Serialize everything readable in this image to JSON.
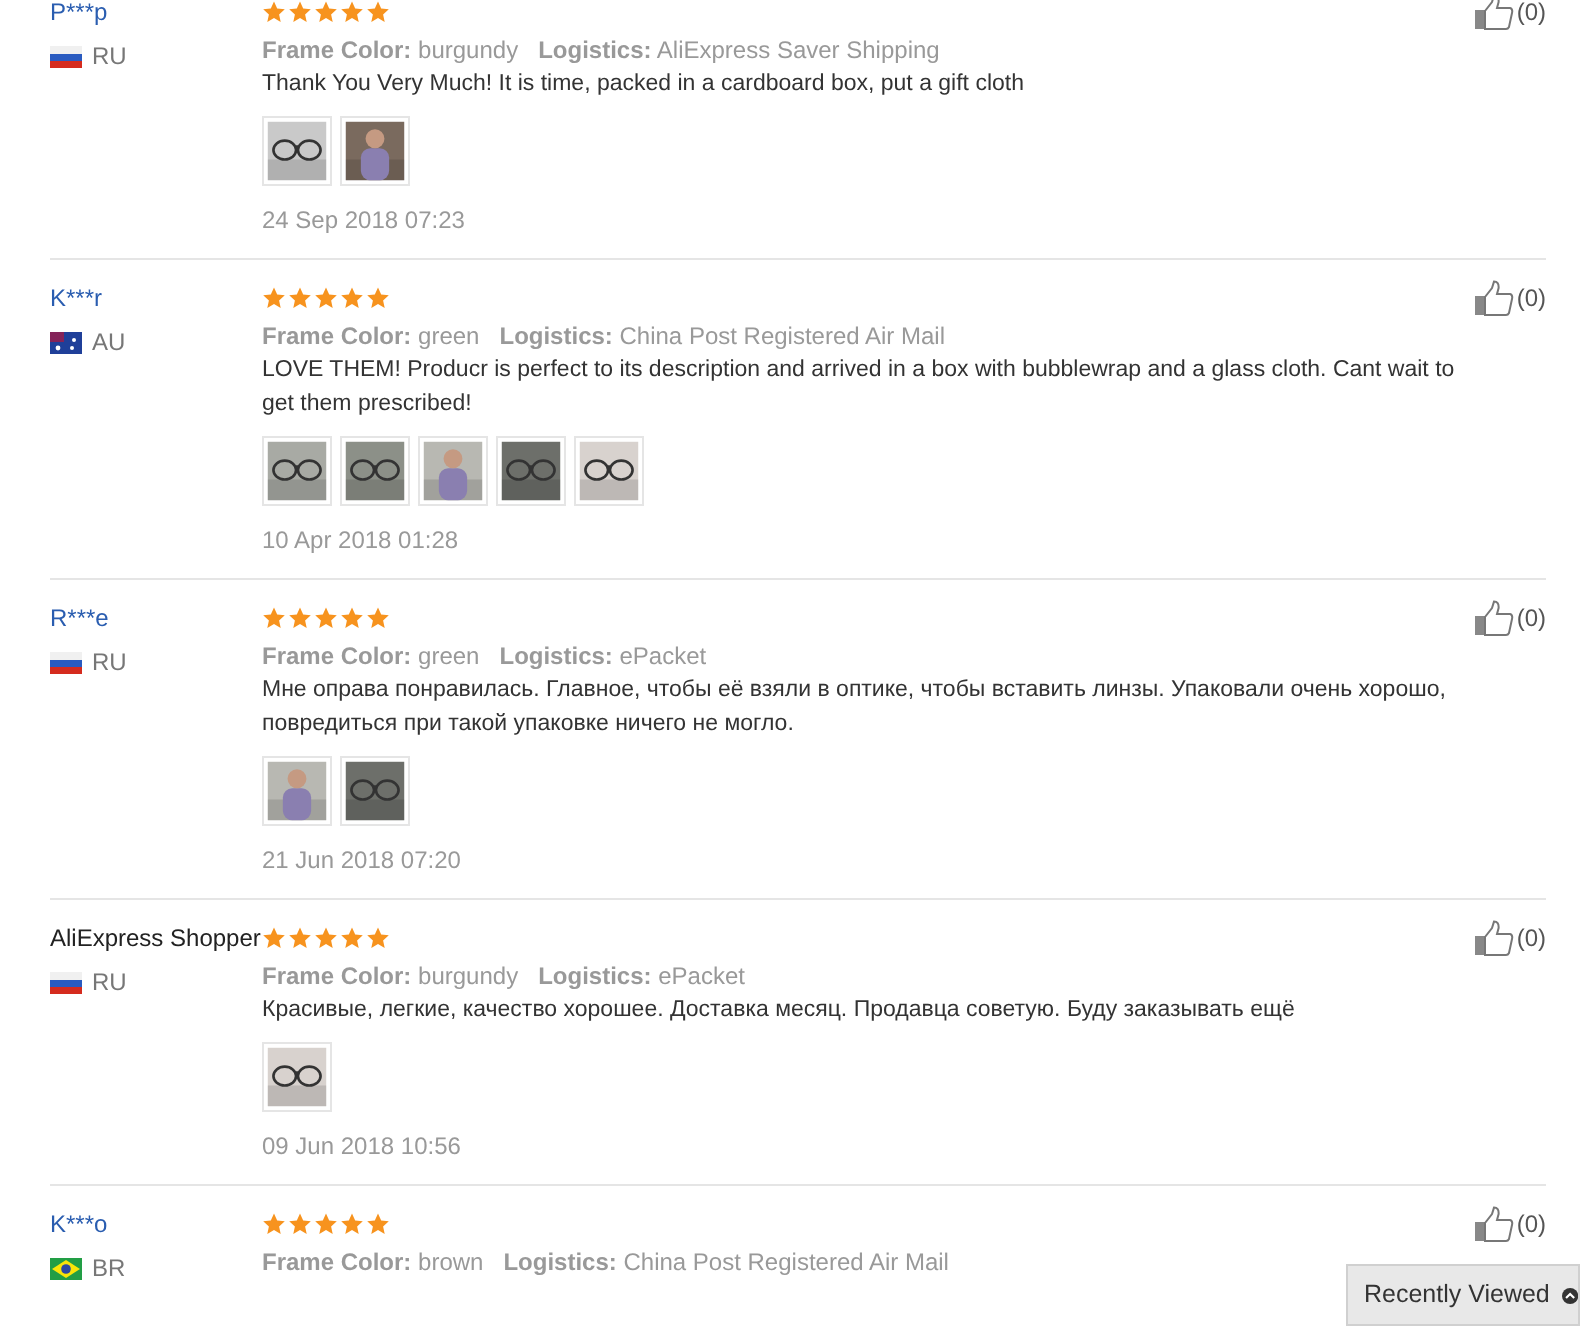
{
  "reviews": [
    {
      "name": "P***p",
      "kind": "masked",
      "flag": {
        "kind": "ru"
      },
      "country": "RU",
      "stars": 5,
      "frame_label": "Frame Color:",
      "frame_value": "burgundy",
      "logistics_label": "Logistics:",
      "logistics_value": "AliExpress Saver Shipping",
      "text": "Thank You Very Much! It is time, packed in a cardboard box, put a gift cloth",
      "photos": [
        {
          "kind": "picture"
        },
        {
          "kind": "picture"
        }
      ],
      "date": "24 Sep 2018 07:23",
      "likes": "(0)"
    },
    {
      "name": "K***r",
      "kind": "masked",
      "flag": {
        "kind": "au"
      },
      "country": "AU",
      "stars": 5,
      "frame_label": "Frame Color:",
      "frame_value": "green",
      "logistics_label": "Logistics:",
      "logistics_value": "China Post Registered Air Mail",
      "text": "LOVE THEM! Producr is perfect to its description and arrived in a box with bubblewrap and a glass cloth. Cant wait to get them prescribed!",
      "photos": [
        {
          "kind": "picture"
        },
        {
          "kind": "picture"
        },
        {
          "kind": "picture"
        },
        {
          "kind": "picture"
        },
        {
          "kind": "picture"
        }
      ],
      "date": "10 Apr 2018 01:28",
      "likes": "(0)"
    },
    {
      "name": "R***e",
      "kind": "masked",
      "flag": {
        "kind": "ru"
      },
      "country": "RU",
      "stars": 5,
      "frame_label": "Frame Color:",
      "frame_value": "green",
      "logistics_label": "Logistics:",
      "logistics_value": "ePacket",
      "text": "Мне оправа понравилась. Главное, чтобы её взяли в оптике, чтобы вставить линзы. Упаковали очень хорошо, повредиться при такой упаковке ничего не могло.",
      "photos": [
        {
          "kind": "picture"
        },
        {
          "kind": "picture"
        }
      ],
      "date": "21 Jun 2018 07:20",
      "likes": "(0)"
    },
    {
      "name": "AliExpress Shopper",
      "kind": "plain",
      "flag": {
        "kind": "ru"
      },
      "country": "RU",
      "stars": 5,
      "frame_label": "Frame Color:",
      "frame_value": "burgundy",
      "logistics_label": "Logistics:",
      "logistics_value": "ePacket",
      "text": "Красивые, легкие, качество хорошее. Доставка месяц. Продавца советую. Буду заказывать ещё",
      "photos": [
        {
          "kind": "picture"
        }
      ],
      "date": "09 Jun 2018 10:56",
      "likes": "(0)"
    },
    {
      "name": "K***o",
      "kind": "masked",
      "flag": {
        "kind": "br"
      },
      "country": "BR",
      "stars": 5,
      "frame_label": "Frame Color:",
      "frame_value": "brown",
      "logistics_label": "Logistics:",
      "logistics_value": "China Post Registered Air Mail",
      "likes": "(0)"
    }
  ],
  "recently_viewed": {
    "label": "Recently Viewed"
  }
}
